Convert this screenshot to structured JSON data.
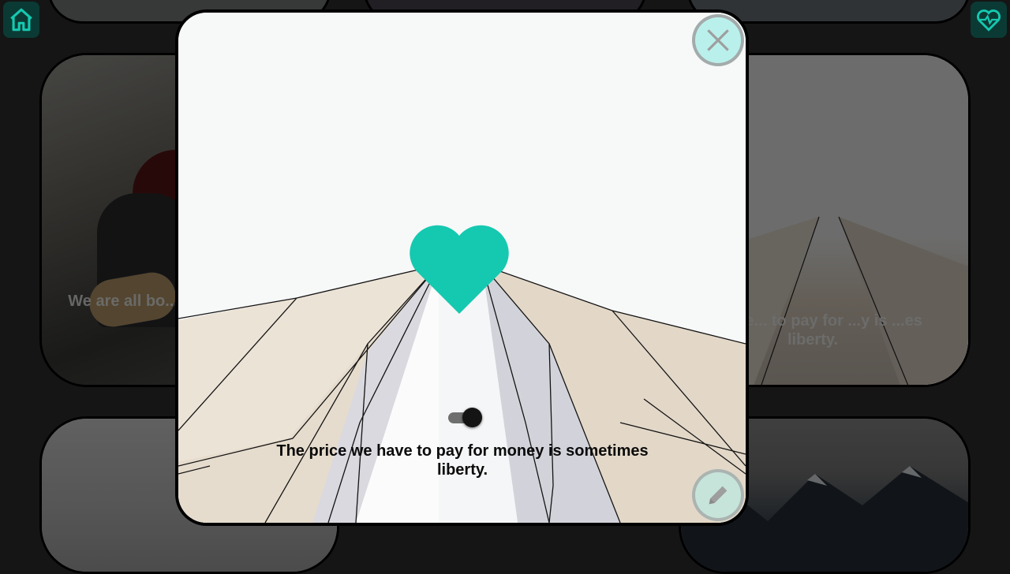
{
  "navigation": {
    "home_icon": "home-icon",
    "favorites_icon": "heart-pulse-icon"
  },
  "background_cards": {
    "musician_quote": "We are all bo... the principle o... its o...",
    "arch_quote": "...price... to pay for ...y is ...es liberty."
  },
  "modal": {
    "quote": "The price we have to pay for money is sometimes liberty.",
    "toggle_state": "on",
    "icons": {
      "close": "close-icon",
      "edit": "pencil-icon",
      "like": "heart-icon"
    }
  },
  "colors": {
    "accent": "#14c9b0",
    "overlay": "#151515",
    "button_fill": "#afeeea"
  }
}
